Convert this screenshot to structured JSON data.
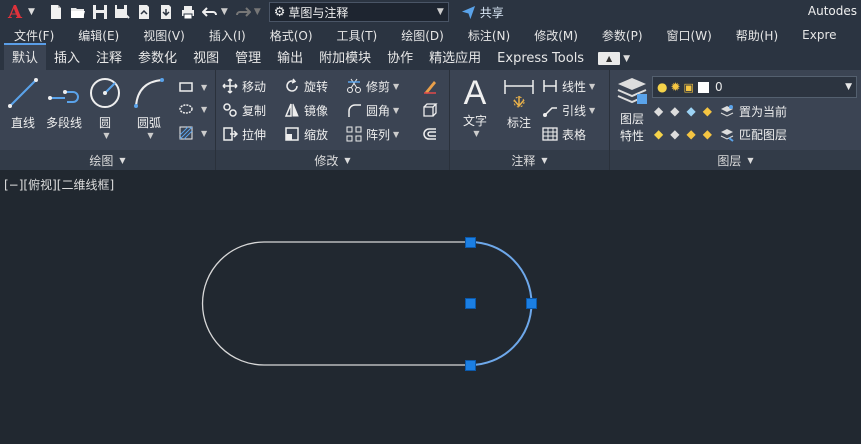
{
  "titlebar": {
    "logo": "A",
    "workspace": "草图与注释",
    "share": "共享",
    "app_title": "Autodes",
    "icons": [
      "new-icon",
      "open-icon",
      "save-icon",
      "saveas-icon",
      "openweb-icon",
      "saveweb-icon",
      "plot-icon",
      "undo-icon",
      "redo-icon"
    ]
  },
  "menu": [
    "文件(F)",
    "编辑(E)",
    "视图(V)",
    "插入(I)",
    "格式(O)",
    "工具(T)",
    "绘图(D)",
    "标注(N)",
    "修改(M)",
    "参数(P)",
    "窗口(W)",
    "帮助(H)",
    "Expre"
  ],
  "tabs": [
    "默认",
    "插入",
    "注释",
    "参数化",
    "视图",
    "管理",
    "输出",
    "附加模块",
    "协作",
    "精选应用",
    "Express Tools"
  ],
  "ribbon": {
    "draw": {
      "title": "绘图",
      "line": "直线",
      "polyline": "多段线",
      "circle": "圆",
      "arc": "圆弧"
    },
    "modify": {
      "title": "修改",
      "move": "移动",
      "rotate": "旋转",
      "trim": "修剪",
      "copy": "复制",
      "mirror": "镜像",
      "fillet": "圆角",
      "stretch": "拉伸",
      "scale": "缩放",
      "array": "阵列"
    },
    "annotation": {
      "title": "注释",
      "text": "文字",
      "dimension": "标注",
      "linear": "线性",
      "leader": "引线",
      "table": "表格"
    },
    "layers": {
      "title": "图层",
      "properties_line1": "图层",
      "properties_line2": "特性",
      "current_layer": "0",
      "set_current": "置为当前",
      "match_layer": "匹配图层"
    }
  },
  "viewport": {
    "label": "[−][俯视][二维线框]"
  },
  "colors": {
    "accent": "#1b7fe3",
    "canvas": "#212830",
    "ribbon": "#3b4453",
    "selected_edge": "#6ea8ea"
  }
}
